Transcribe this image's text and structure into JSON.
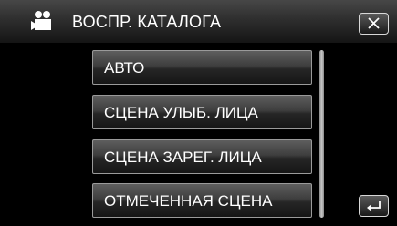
{
  "header": {
    "mode_icon": "video-camera-icon",
    "title": "ВОСПР. КАТАЛОГА",
    "close_icon": "close-icon"
  },
  "menu": {
    "items": [
      {
        "label": "АВТО"
      },
      {
        "label": "СЦЕНА УЛЫБ. ЛИЦА"
      },
      {
        "label": "СЦЕНА ЗАРЕГ. ЛИЦА"
      },
      {
        "label": "ОТМЕЧЕННАЯ СЦЕНА"
      }
    ]
  },
  "footer": {
    "back_icon": "return-icon"
  },
  "colors": {
    "background": "#000000",
    "text": "#ffffff",
    "button_border": "#9a9a9a"
  }
}
